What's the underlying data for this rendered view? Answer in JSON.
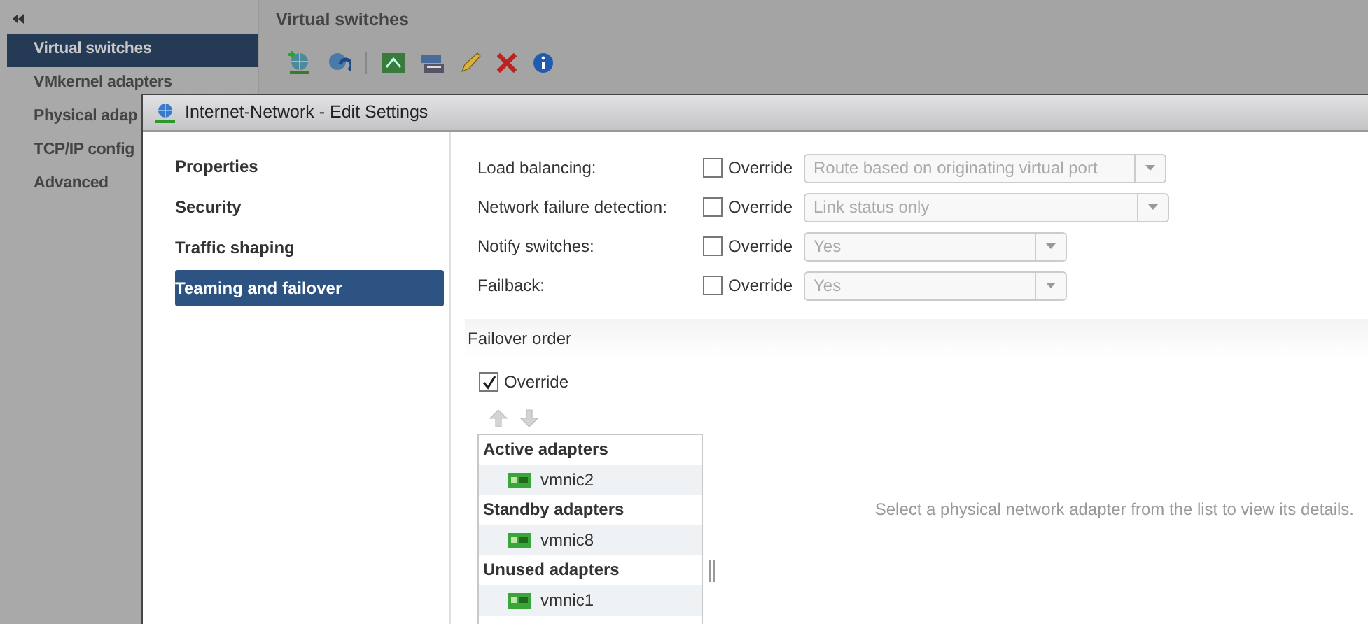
{
  "sidebar": {
    "items": [
      {
        "label": "Virtual switches",
        "selected": true
      },
      {
        "label": "VMkernel adapters",
        "selected": false
      },
      {
        "label": "Physical adap",
        "selected": false
      },
      {
        "label": "TCP/IP config",
        "selected": false
      },
      {
        "label": "Advanced",
        "selected": false
      }
    ]
  },
  "main": {
    "title": "Virtual switches"
  },
  "dialog": {
    "title": "Internet-Network - Edit Settings",
    "nav": [
      {
        "label": "Properties",
        "selected": false
      },
      {
        "label": "Security",
        "selected": false
      },
      {
        "label": "Traffic shaping",
        "selected": false
      },
      {
        "label": "Teaming and failover",
        "selected": true
      }
    ],
    "settings": [
      {
        "label": "Load balancing:",
        "override_label": "Override",
        "checked": false,
        "value": "Route based on originating virtual port",
        "kind": "wide",
        "disabled": true
      },
      {
        "label": "Network failure detection:",
        "override_label": "Override",
        "checked": false,
        "value": "Link status only",
        "kind": "wide",
        "disabled": true
      },
      {
        "label": "Notify switches:",
        "override_label": "Override",
        "checked": false,
        "value": "Yes",
        "kind": "narrow",
        "disabled": true
      },
      {
        "label": "Failback:",
        "override_label": "Override",
        "checked": false,
        "value": "Yes",
        "kind": "narrow",
        "disabled": true
      }
    ],
    "failover": {
      "heading": "Failover order",
      "override_label": "Override",
      "checked": true,
      "groups": [
        {
          "heading": "Active adapters",
          "adapters": [
            {
              "name": "vmnic2"
            }
          ]
        },
        {
          "heading": "Standby adapters",
          "adapters": [
            {
              "name": "vmnic8"
            }
          ]
        },
        {
          "heading": "Unused adapters",
          "adapters": [
            {
              "name": "vmnic1"
            }
          ]
        }
      ],
      "hint": "Select a physical network adapter from the list to view its details."
    }
  }
}
